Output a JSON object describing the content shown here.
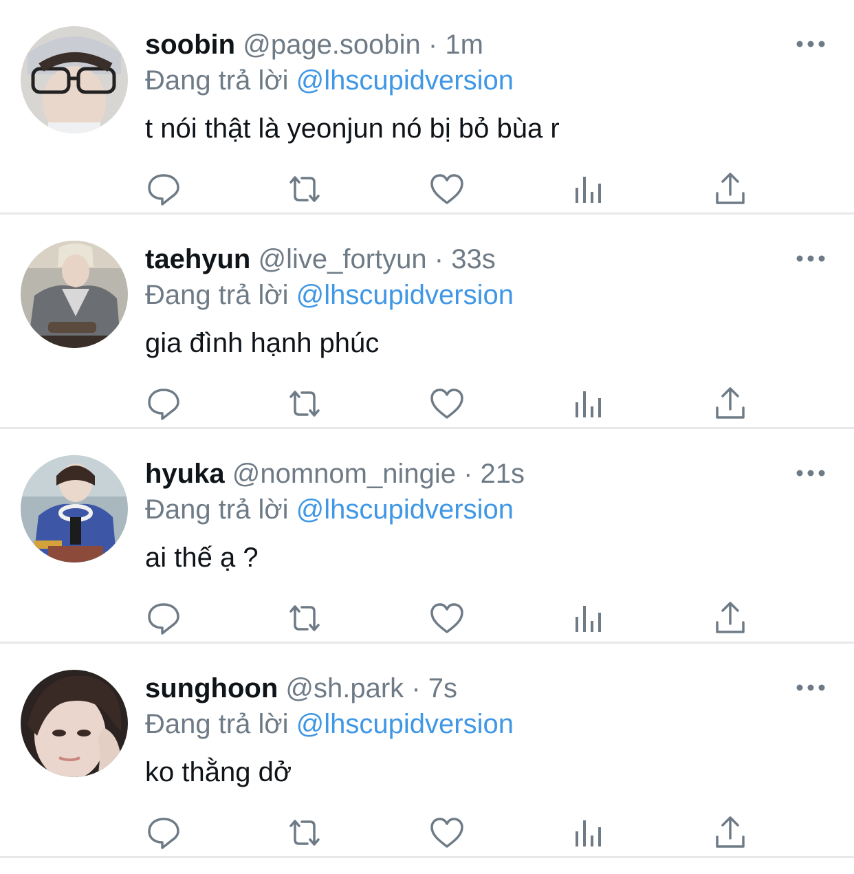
{
  "accent_colors": {
    "link": "#3f97e5",
    "muted_text": "#6e7b86",
    "primary_text": "#0f1419",
    "icon": "#6e7b86",
    "divider": "#e6e8ea"
  },
  "icons": {
    "reply": "speech-bubble-icon",
    "retweet": "retweet-arrows-icon",
    "like": "heart-outline-icon",
    "views": "bar-chart-icon",
    "share": "upload-arrow-icon",
    "more": "three-dots-icon"
  },
  "tweets": [
    {
      "display_name": "soobin",
      "handle": "@page.soobin",
      "separator": "·",
      "time": "1m",
      "reply_prefix": "Đang trả lời",
      "reply_target": "@lhscupidversion",
      "text": "t nói thật là yeonjun nó bị bỏ bùa r"
    },
    {
      "display_name": "taehyun",
      "handle": "@live_fortyun",
      "separator": "·",
      "time": "33s",
      "reply_prefix": "Đang trả lời",
      "reply_target": "@lhscupidversion",
      "text": "gia đình hạnh phúc"
    },
    {
      "display_name": "hyuka",
      "handle": "@nomnom_ningie",
      "separator": "·",
      "time": "21s",
      "reply_prefix": "Đang trả lời",
      "reply_target": "@lhscupidversion",
      "text": "ai thế ạ ?"
    },
    {
      "display_name": "sunghoon",
      "handle": "@sh.park",
      "separator": "·",
      "time": "7s",
      "reply_prefix": "Đang trả lời",
      "reply_target": "@lhscupidversion",
      "text": "ko thằng dở"
    }
  ]
}
